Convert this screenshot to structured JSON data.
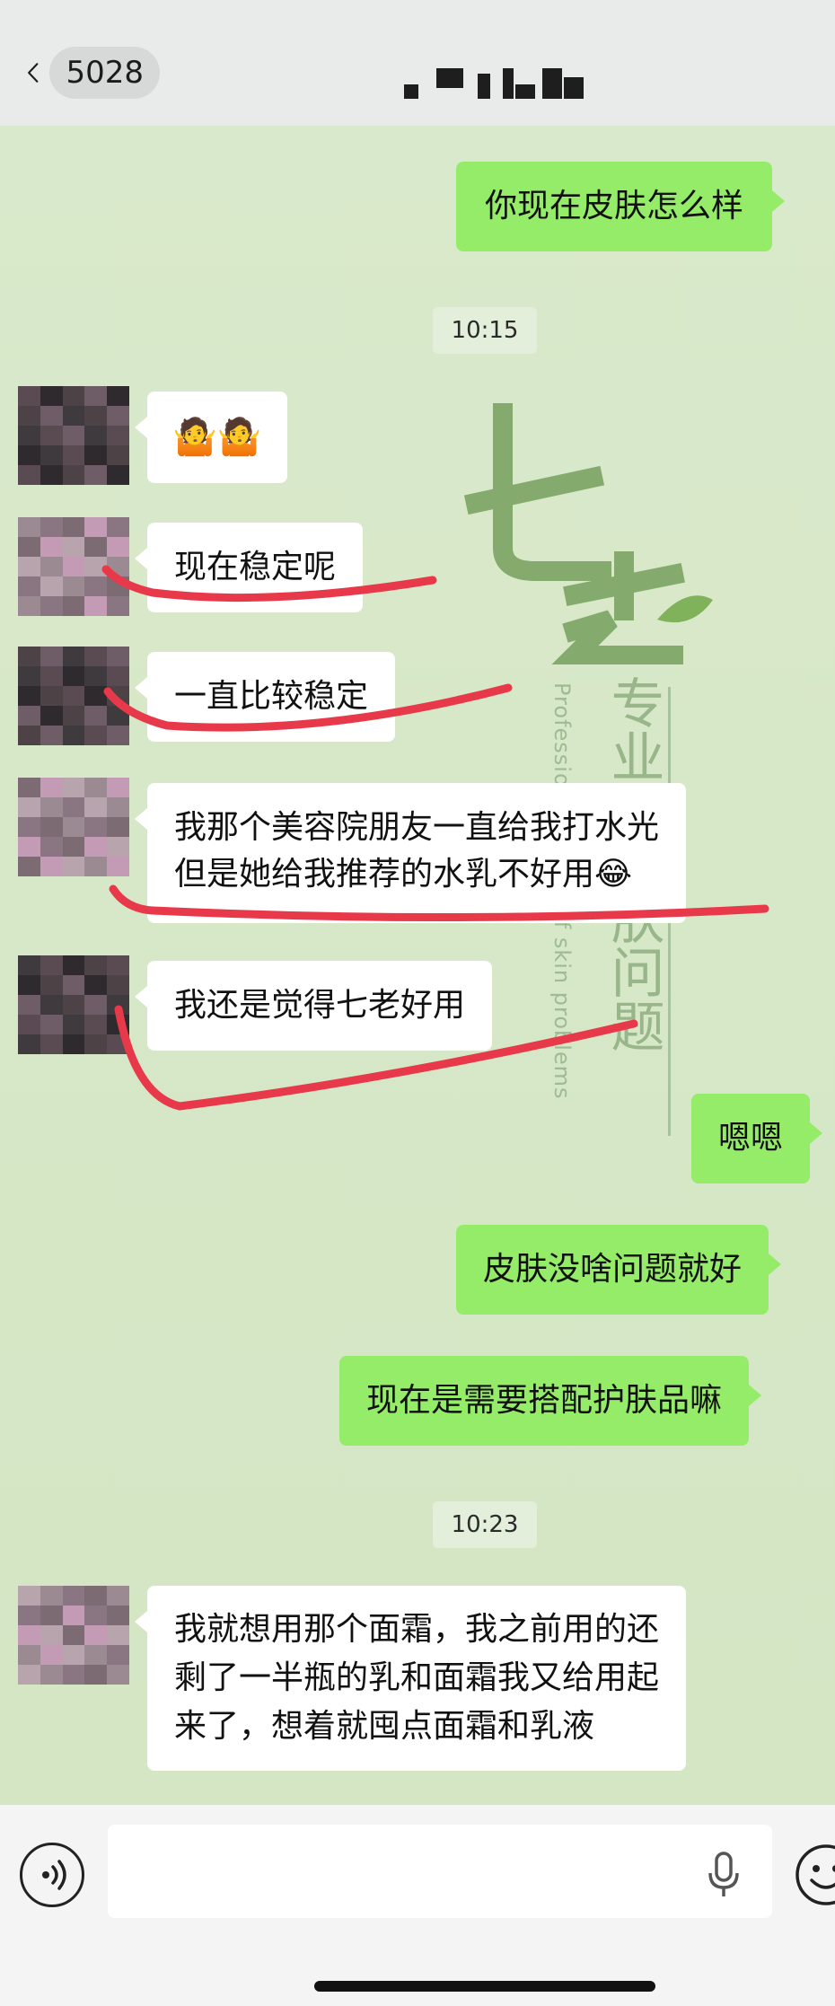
{
  "header": {
    "unread_count": "5028"
  },
  "watermark": {
    "brand": "七老",
    "slogan": "专业修复肤问题",
    "english": "Professional repair of skin problems"
  },
  "messages": [
    {
      "from": "me",
      "text": "你现在皮肤怎么样"
    },
    {
      "timestamp": "10:15"
    },
    {
      "from": "contact",
      "text": "🤷🤷"
    },
    {
      "from": "contact",
      "text": "现在稳定呢"
    },
    {
      "from": "contact",
      "text": "一直比较稳定"
    },
    {
      "from": "contact",
      "lines": [
        "我那个美容院朋友一直给我打水光",
        "但是她给我推荐的水乳不好用😂"
      ]
    },
    {
      "from": "contact",
      "text": "我还是觉得七老好用"
    },
    {
      "from": "me",
      "text": "嗯嗯"
    },
    {
      "from": "me",
      "text": "皮肤没啥问题就好"
    },
    {
      "from": "me",
      "text": "现在是需要搭配护肤品嘛"
    },
    {
      "timestamp": "10:23"
    },
    {
      "from": "contact",
      "lines": [
        "我就想用那个面霜，我之前用的还",
        "剩了一半瓶的乳和面霜我又给用起",
        "来了，想着就囤点面霜和乳液"
      ]
    }
  ],
  "input": {
    "value": "",
    "placeholder": ""
  },
  "icons": {
    "back": "chevron-left-icon",
    "voice": "voice-icon",
    "mic": "microphone-icon",
    "emoji": "emoji-icon"
  },
  "colors": {
    "outgoing_bubble": "#95ec69",
    "incoming_bubble": "#ffffff",
    "highlight_stroke": "#e8394a"
  }
}
